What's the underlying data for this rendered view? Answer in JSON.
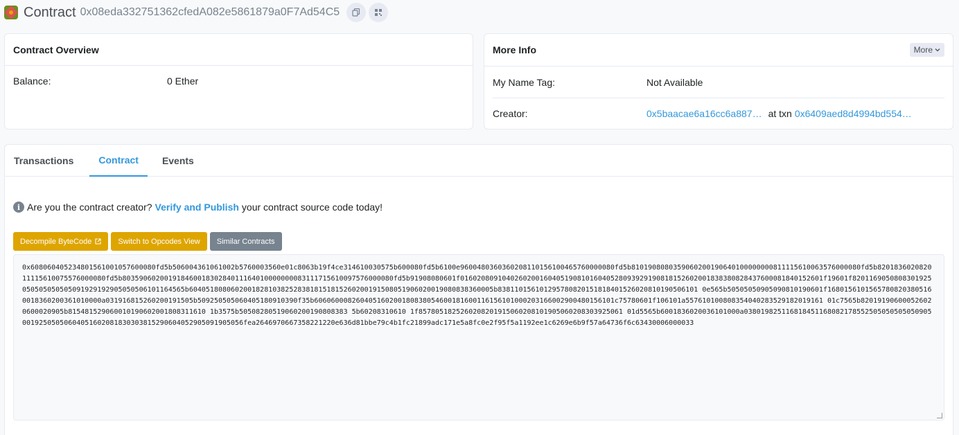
{
  "header": {
    "title": "Contract",
    "address": "0x08eda332751362cfedA082e5861879a0F7Ad54C5"
  },
  "overview": {
    "title": "Contract Overview",
    "balance_label": "Balance:",
    "balance_value": "0 Ether"
  },
  "more_info": {
    "title": "More Info",
    "more_button": "More",
    "name_tag_label": "My Name Tag:",
    "name_tag_value": "Not Available",
    "creator_label": "Creator:",
    "creator_address": "0x5baacae6a16cc6a887…",
    "at_txn_label": "at txn",
    "creator_txn": "0x6409aed8d4994bd554…"
  },
  "tabs": [
    {
      "label": "Transactions"
    },
    {
      "label": "Contract"
    },
    {
      "label": "Events"
    }
  ],
  "active_tab": "Contract",
  "notice": {
    "prefix": "Are you the contract creator?",
    "link": "Verify and Publish",
    "suffix": "your contract source code today!"
  },
  "buttons": {
    "decompile": "Decompile ByteCode",
    "switch_opcodes": "Switch to Opcodes View",
    "similar": "Similar Contracts"
  },
  "bytecode": "0x608060405234801561001057600080fd5b506004361061002b5760003560e01c8063b19f4ce314610030575b600080fd5b6100e9600480360360208110156100465760000080fd5b8101908080359060200190640100000000811115610063576000080fd5b820183602082011115610075576000080fd5b80359060200191846001830284011164010000000083111715610097576000080fd5b91908080601f016020809104026020016040519081016040528093929190818152602001838380828437600081840152601f19601f8201169050808301925050505050505091929192905050506101164565b6040518080602001828103825283818151815260200191508051906020019080838360005b838110156101295780820151818401526020810190506101 0e565b50505050905090810190601f16801561015657808203805160018360200361010000a031916815260200191505b509250505060405180910390f35b606060008260405160200180838054600181600116156101000203166002900480156101c75780601f106101a557610100808354040283529182019161 01c7565b820191906000526020600020905b815481529060010190602001808311610 1b3575b50508280519060200190808383 5b60208310610 1f8578051825260208201915060208101905060208303925061 01d5565b6001836020036101000a03801982511681845116808217855250505050505090500192505050604051602081830303815290604052905091905056fea2646970667358221220e636d81bbe79c4b1fc21899adc171e5a8fc0e2f95f5a1192ee1c6269e6b9f57a64736f6c63430006000033"
}
